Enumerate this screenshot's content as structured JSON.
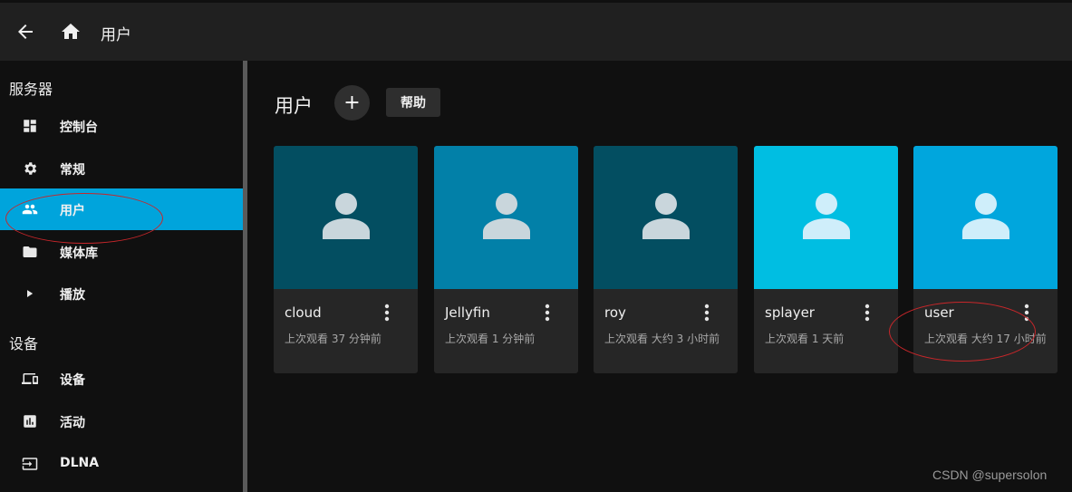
{
  "header": {
    "title": "用户",
    "back_icon": "arrow-back-icon",
    "home_icon": "home-icon"
  },
  "sidebar": {
    "sections": [
      {
        "title": "服务器",
        "items": [
          {
            "label": "控制台",
            "icon": "dashboard-icon",
            "active": false
          },
          {
            "label": "常规",
            "icon": "gear-icon",
            "active": false
          },
          {
            "label": "用户",
            "icon": "people-icon",
            "active": true
          },
          {
            "label": "媒体库",
            "icon": "folder-icon",
            "active": false
          },
          {
            "label": "播放",
            "icon": "play-icon",
            "active": false
          }
        ]
      },
      {
        "title": "设备",
        "items": [
          {
            "label": "设备",
            "icon": "devices-icon",
            "active": false
          },
          {
            "label": "活动",
            "icon": "chart-icon",
            "active": false
          },
          {
            "label": "DLNA",
            "icon": "input-icon",
            "active": false
          }
        ]
      }
    ]
  },
  "main": {
    "title": "用户",
    "add_label": "+",
    "help_label": "帮助",
    "users": [
      {
        "name": "cloud",
        "last_seen": "上次观看 37 分钟前",
        "color": "#034e61"
      },
      {
        "name": "Jellyfin",
        "last_seen": "上次观看 1 分钟前",
        "color": "#0280a8"
      },
      {
        "name": "roy",
        "last_seen": "上次观看 大约 3 小时前",
        "color": "#034e61"
      },
      {
        "name": "splayer",
        "last_seen": "上次观看 1 天前",
        "color": "#00bee2"
      },
      {
        "name": "user",
        "last_seen": "上次观看 大约 17 小时前",
        "color": "#00a6dd"
      }
    ]
  },
  "colors": {
    "accent": "#00a4dc",
    "annotation": "#c8262a"
  },
  "watermark": "CSDN @supersolon"
}
